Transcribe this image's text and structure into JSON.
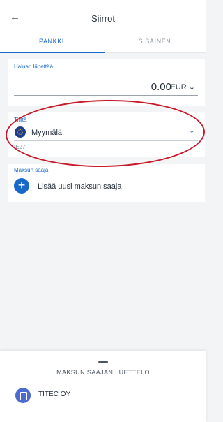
{
  "header": {
    "back_icon": "arrow-left",
    "title": "Siirrot",
    "tabs": [
      {
        "label": "PANKKI",
        "active": true
      },
      {
        "label": "SISÄINEN",
        "active": false
      }
    ]
  },
  "amount": {
    "label": "Haluan lähettää",
    "value": "0.00",
    "currency": "EUR"
  },
  "from_account": {
    "label": "Tililtä",
    "name": "Myymälä",
    "iban": "IE27"
  },
  "payee": {
    "label": "Maksun saaja",
    "add_label": "Lisää uusi maksun saaja"
  },
  "payee_list": {
    "title": "MAKSUN SAAJAN LUETTELO",
    "items": [
      {
        "name": "TITEC OY"
      }
    ]
  },
  "colors": {
    "accent": "#1868c9",
    "highlight": "#c8192a"
  }
}
